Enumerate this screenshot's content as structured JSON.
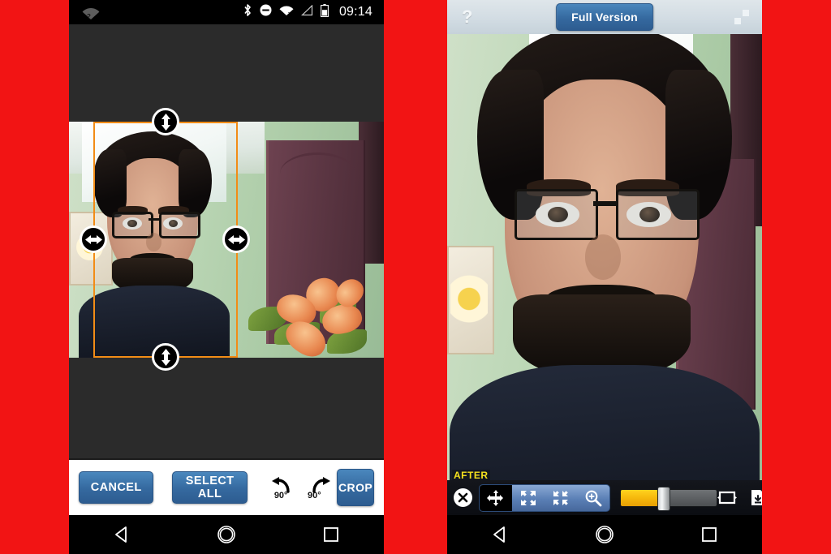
{
  "background": {
    "color": "#f21414"
  },
  "left_phone": {
    "statusbar": {
      "time": "09:14",
      "icons": [
        {
          "name": "wifi-question-icon"
        },
        {
          "name": "bluetooth-icon"
        },
        {
          "name": "do-not-disturb-icon"
        },
        {
          "name": "wifi-disconnected-icon"
        },
        {
          "name": "cellular-signal-icon"
        },
        {
          "name": "battery-icon"
        }
      ]
    },
    "editor": {
      "canvas_background": "#2b2b2b",
      "crop_border_color": "#f28c16",
      "handles": [
        {
          "name": "crop-handle-top",
          "direction": "vertical"
        },
        {
          "name": "crop-handle-bottom",
          "direction": "vertical"
        },
        {
          "name": "crop-handle-left",
          "direction": "horizontal"
        },
        {
          "name": "crop-handle-right",
          "direction": "horizontal"
        }
      ]
    },
    "buttons": {
      "cancel_label": "CANCEL",
      "select_all_label": "SELECT ALL",
      "crop_label": "CROP",
      "rotate_left_degrees": "90",
      "rotate_right_degrees": "90",
      "button_color": "#35699f"
    }
  },
  "right_phone": {
    "topbar": {
      "help_label": "?",
      "full_version_label": "Full Version",
      "expand_icon": "fullscreen-expand-icon"
    },
    "overlay": {
      "after_label": "AFTER",
      "after_color": "#f5e11e"
    },
    "toolbar": {
      "close_icon": "close-icon",
      "tools": [
        {
          "name": "move-tool",
          "icon": "move-arrows-icon",
          "active": true
        },
        {
          "name": "expand-tool",
          "icon": "expand-out-arrows-icon",
          "active": false
        },
        {
          "name": "shrink-tool",
          "icon": "collapse-in-arrows-icon",
          "active": false
        },
        {
          "name": "zoom-tool",
          "icon": "magnifier-plus-icon",
          "active": false
        }
      ],
      "slider": {
        "name": "intensity-slider",
        "value_percent": 45,
        "fill_color": "#f6b80c"
      },
      "flip_icon": "flip-frame-icon",
      "save_icon": "save-download-icon"
    }
  },
  "navbar": {
    "back_label": "back-icon",
    "home_label": "home-icon",
    "recents_label": "recents-icon"
  }
}
